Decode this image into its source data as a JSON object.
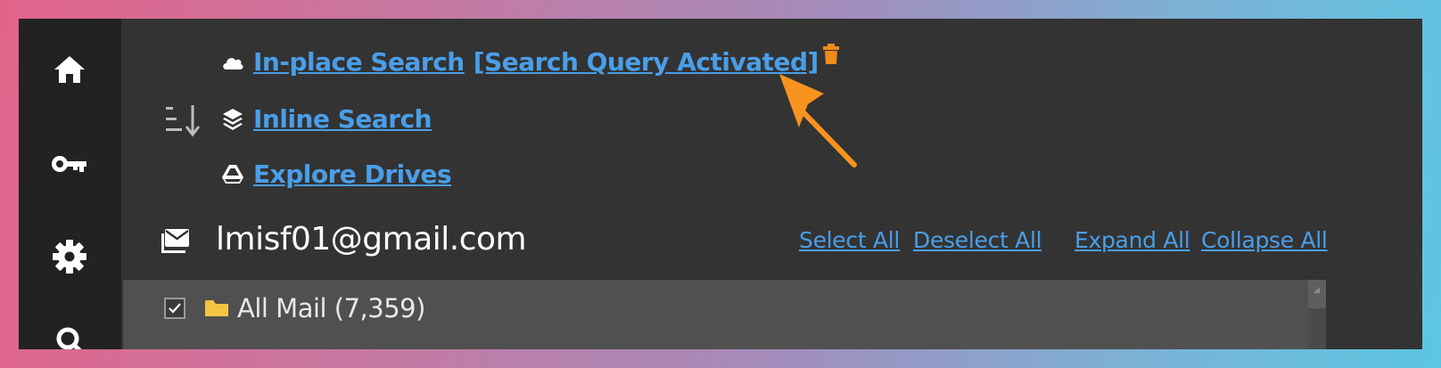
{
  "sidebar": {
    "items": [
      {
        "icon": "home-icon"
      },
      {
        "icon": "key-icon"
      },
      {
        "icon": "gear-icon"
      },
      {
        "icon": "search-icon"
      }
    ]
  },
  "nav": {
    "in_place_search_label": "In-place Search",
    "search_query_label": "[Search Query Activated]",
    "inline_search_label": "Inline Search",
    "explore_drives_label": "Explore Drives"
  },
  "account": {
    "email": "lmisf01@gmail.com",
    "select_all": "Select All",
    "deselect_all": "Deselect All",
    "expand_all": "Expand All",
    "collapse_all": "Collapse All"
  },
  "tree": {
    "items": [
      {
        "label": "All Mail (7,359)",
        "checked": true
      }
    ]
  },
  "colors": {
    "link": "#4a9ee8",
    "trash_icon": "#f08a1a",
    "arrow_annotation": "#f7931e",
    "folder": "#f5c542"
  }
}
